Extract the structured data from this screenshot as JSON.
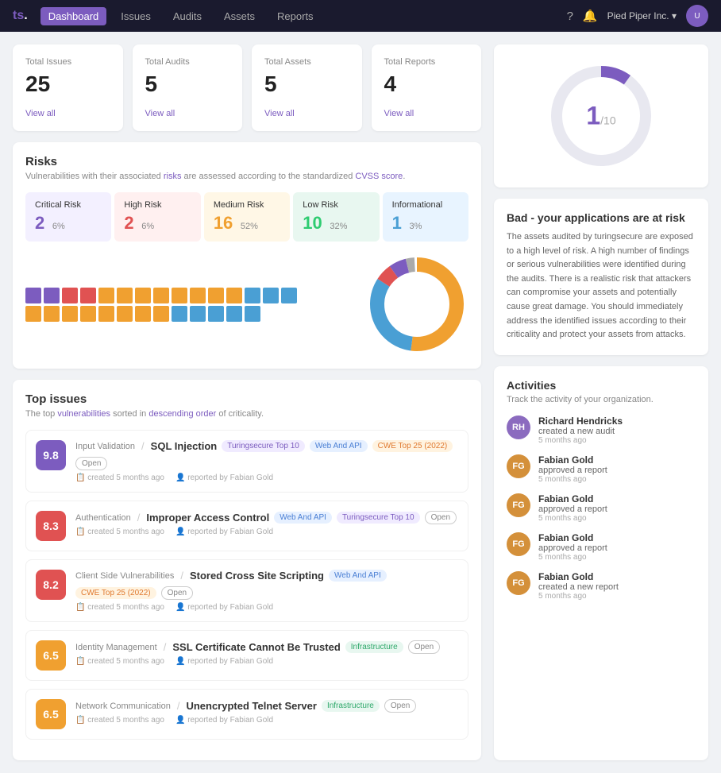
{
  "nav": {
    "logo": "ts.",
    "items": [
      "Dashboard",
      "Issues",
      "Audits",
      "Assets",
      "Reports"
    ],
    "active": "Dashboard",
    "org": "Pied Piper Inc.",
    "breadcrumb": "Reports"
  },
  "stats": [
    {
      "label": "Total Issues",
      "value": "25",
      "link": "View all"
    },
    {
      "label": "Total Audits",
      "value": "5",
      "link": "View all"
    },
    {
      "label": "Total Assets",
      "value": "5",
      "link": "View all"
    },
    {
      "label": "Total Reports",
      "value": "4",
      "link": "View all"
    }
  ],
  "risks": {
    "title": "Risks",
    "subtitle": "Vulnerabilities with their associated risks are assessed according to the standardized CVSS score.",
    "levels": [
      {
        "label": "Critical Risk",
        "count": "2",
        "pct": "6%",
        "cls": "rl-critical",
        "color": "risk-critical-color"
      },
      {
        "label": "High Risk",
        "count": "2",
        "pct": "6%",
        "cls": "rl-high",
        "color": "risk-high-color"
      },
      {
        "label": "Medium Risk",
        "count": "16",
        "pct": "52%",
        "cls": "rl-medium",
        "color": "risk-medium-color"
      },
      {
        "label": "Low Risk",
        "count": "10",
        "pct": "32%",
        "cls": "rl-low",
        "color": "risk-low-color"
      },
      {
        "label": "Informational",
        "count": "1",
        "pct": "3%",
        "cls": "rl-info",
        "color": "risk-info-color"
      }
    ]
  },
  "score": {
    "value": "1",
    "denom": "/10"
  },
  "risk_status": {
    "title": "Bad - your applications are at risk",
    "desc": "The assets audited by turingsecure are exposed to a high level of risk. A high number of findings or serious vulnerabilities were identified during the audits. There is a realistic risk that attackers can compromise your assets and potentially cause great damage. You should immediately address the identified issues according to their criticality and protect your assets from attacks."
  },
  "activities": {
    "title": "Activities",
    "subtitle": "Track the activity of your organization.",
    "items": [
      {
        "name": "Richard Hendricks",
        "action": "created a new audit",
        "time": "5 months ago",
        "initials": "RH",
        "bg": "#8b6bbf"
      },
      {
        "name": "Fabian Gold",
        "action": "approved a report",
        "time": "5 months ago",
        "initials": "FG",
        "bg": "#d4903a"
      },
      {
        "name": "Fabian Gold",
        "action": "approved a report",
        "time": "5 months ago",
        "initials": "FG",
        "bg": "#d4903a"
      },
      {
        "name": "Fabian Gold",
        "action": "approved a report",
        "time": "5 months ago",
        "initials": "FG",
        "bg": "#d4903a"
      },
      {
        "name": "Fabian Gold",
        "action": "created a new report",
        "time": "5 months ago",
        "initials": "FG",
        "bg": "#d4903a"
      }
    ]
  },
  "top_issues": {
    "title": "Top issues",
    "subtitle": "The top vulnerabilities sorted in descending order of criticality.",
    "items": [
      {
        "score": "9.8",
        "score_cls": "score-critical",
        "category": "Input Validation",
        "name": "SQL Injection",
        "tags": [
          "Turingsecure Top 10",
          "Web And API",
          "CWE Top 25 (2022)",
          "Open"
        ],
        "tag_styles": [
          "tag-purple",
          "tag-blue",
          "tag-orange",
          "tag-open"
        ],
        "created": "created 5 months ago",
        "reporter": "reported by Fabian Gold"
      },
      {
        "score": "8.3",
        "score_cls": "score-high",
        "category": "Authentication",
        "name": "Improper Access Control",
        "tags": [
          "Web And API",
          "Turingsecure Top 10",
          "Open"
        ],
        "tag_styles": [
          "tag-blue",
          "tag-purple",
          "tag-open"
        ],
        "created": "created 5 months ago",
        "reporter": "reported by Fabian Gold"
      },
      {
        "score": "8.2",
        "score_cls": "score-high",
        "category": "Client Side Vulnerabilities",
        "name": "Stored Cross Site Scripting",
        "tags": [
          "Web And API",
          "CWE Top 25 (2022)",
          "Open"
        ],
        "tag_styles": [
          "tag-blue",
          "tag-orange",
          "tag-open"
        ],
        "created": "created 5 months ago",
        "reporter": "reported by Fabian Gold"
      },
      {
        "score": "6.5",
        "score_cls": "score-medium",
        "category": "Identity Management",
        "name": "SSL Certificate Cannot Be Trusted",
        "tags": [
          "Infrastructure",
          "Open"
        ],
        "tag_styles": [
          "tag-green",
          "tag-open"
        ],
        "created": "created 5 months ago",
        "reporter": "reported by Fabian Gold"
      },
      {
        "score": "6.5",
        "score_cls": "score-medium",
        "category": "Network Communication",
        "name": "Unencrypted Telnet Server",
        "tags": [
          "Infrastructure",
          "Open"
        ],
        "tag_styles": [
          "tag-green",
          "tag-open"
        ],
        "created": "created 5 months ago",
        "reporter": "reported by Fabian Gold"
      }
    ]
  },
  "donut": {
    "segments": [
      {
        "value": 52,
        "color": "#f0a030"
      },
      {
        "value": 32,
        "color": "#4a9fd4"
      },
      {
        "value": 6,
        "color": "#e05252"
      },
      {
        "value": 6,
        "color": "#7c5cbf"
      },
      {
        "value": 3,
        "color": "#aaaaaa"
      }
    ]
  }
}
